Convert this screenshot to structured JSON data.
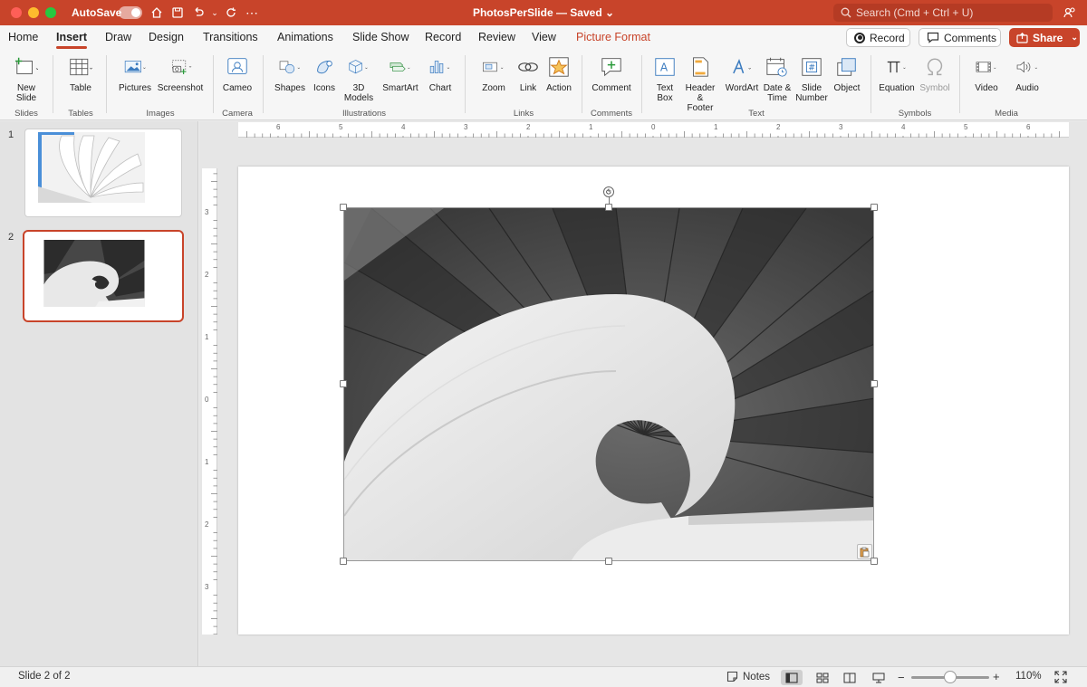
{
  "titlebar": {
    "autosave_label": "AutoSave",
    "document_title": "PhotosPerSlide — Saved",
    "search_placeholder": "Search (Cmd + Ctrl + U)"
  },
  "tabs": [
    {
      "label": "Home",
      "name": "tab-home"
    },
    {
      "label": "Insert",
      "name": "tab-insert",
      "active": true
    },
    {
      "label": "Draw",
      "name": "tab-draw"
    },
    {
      "label": "Design",
      "name": "tab-design"
    },
    {
      "label": "Transitions",
      "name": "tab-transitions"
    },
    {
      "label": "Animations",
      "name": "tab-animations"
    },
    {
      "label": "Slide Show",
      "name": "tab-slide-show"
    },
    {
      "label": "Record",
      "name": "tab-record"
    },
    {
      "label": "Review",
      "name": "tab-review"
    },
    {
      "label": "View",
      "name": "tab-view"
    },
    {
      "label": "Picture Format",
      "name": "tab-picture-format"
    }
  ],
  "actions": {
    "record_label": "Record",
    "comments_label": "Comments",
    "share_label": "Share"
  },
  "ribbon": {
    "new_slide": "New\nSlide",
    "table": "Table",
    "pictures": "Pictures",
    "screenshot": "Screenshot",
    "cameo": "Cameo",
    "shapes": "Shapes",
    "icons": "Icons",
    "models3d": "3D\nModels",
    "smartart": "SmartArt",
    "chart": "Chart",
    "zoom": "Zoom",
    "link": "Link",
    "action": "Action",
    "comment": "Comment",
    "text_box": "Text\nBox",
    "header_footer": "Header &\nFooter",
    "wordart": "WordArt",
    "date_time": "Date &\nTime",
    "slide_number": "Slide\nNumber",
    "object": "Object",
    "equation": "Equation",
    "symbol": "Symbol",
    "video": "Video",
    "audio": "Audio",
    "groups": {
      "slides": "Slides",
      "tables": "Tables",
      "images": "Images",
      "camera": "Camera",
      "illustrations": "Illustrations",
      "links": "Links",
      "comments": "Comments",
      "text": "Text",
      "symbols": "Symbols",
      "media": "Media"
    }
  },
  "thumbnails": [
    {
      "number": "1"
    },
    {
      "number": "2",
      "selected": true
    }
  ],
  "ruler": {
    "horizontal": [
      "6",
      "5",
      "4",
      "3",
      "2",
      "1",
      "0",
      "1",
      "2",
      "3",
      "4",
      "5",
      "6"
    ],
    "vertical": [
      "3",
      "2",
      "1",
      "0",
      "1",
      "2",
      "3"
    ]
  },
  "statusbar": {
    "slide_info": "Slide 2 of 2",
    "notes_label": "Notes",
    "zoom_level": "110%",
    "zoom_minus": "−",
    "zoom_plus": "+"
  },
  "colors": {
    "accent": "#c8442a",
    "selected_thumb_border": "#c8442a"
  }
}
